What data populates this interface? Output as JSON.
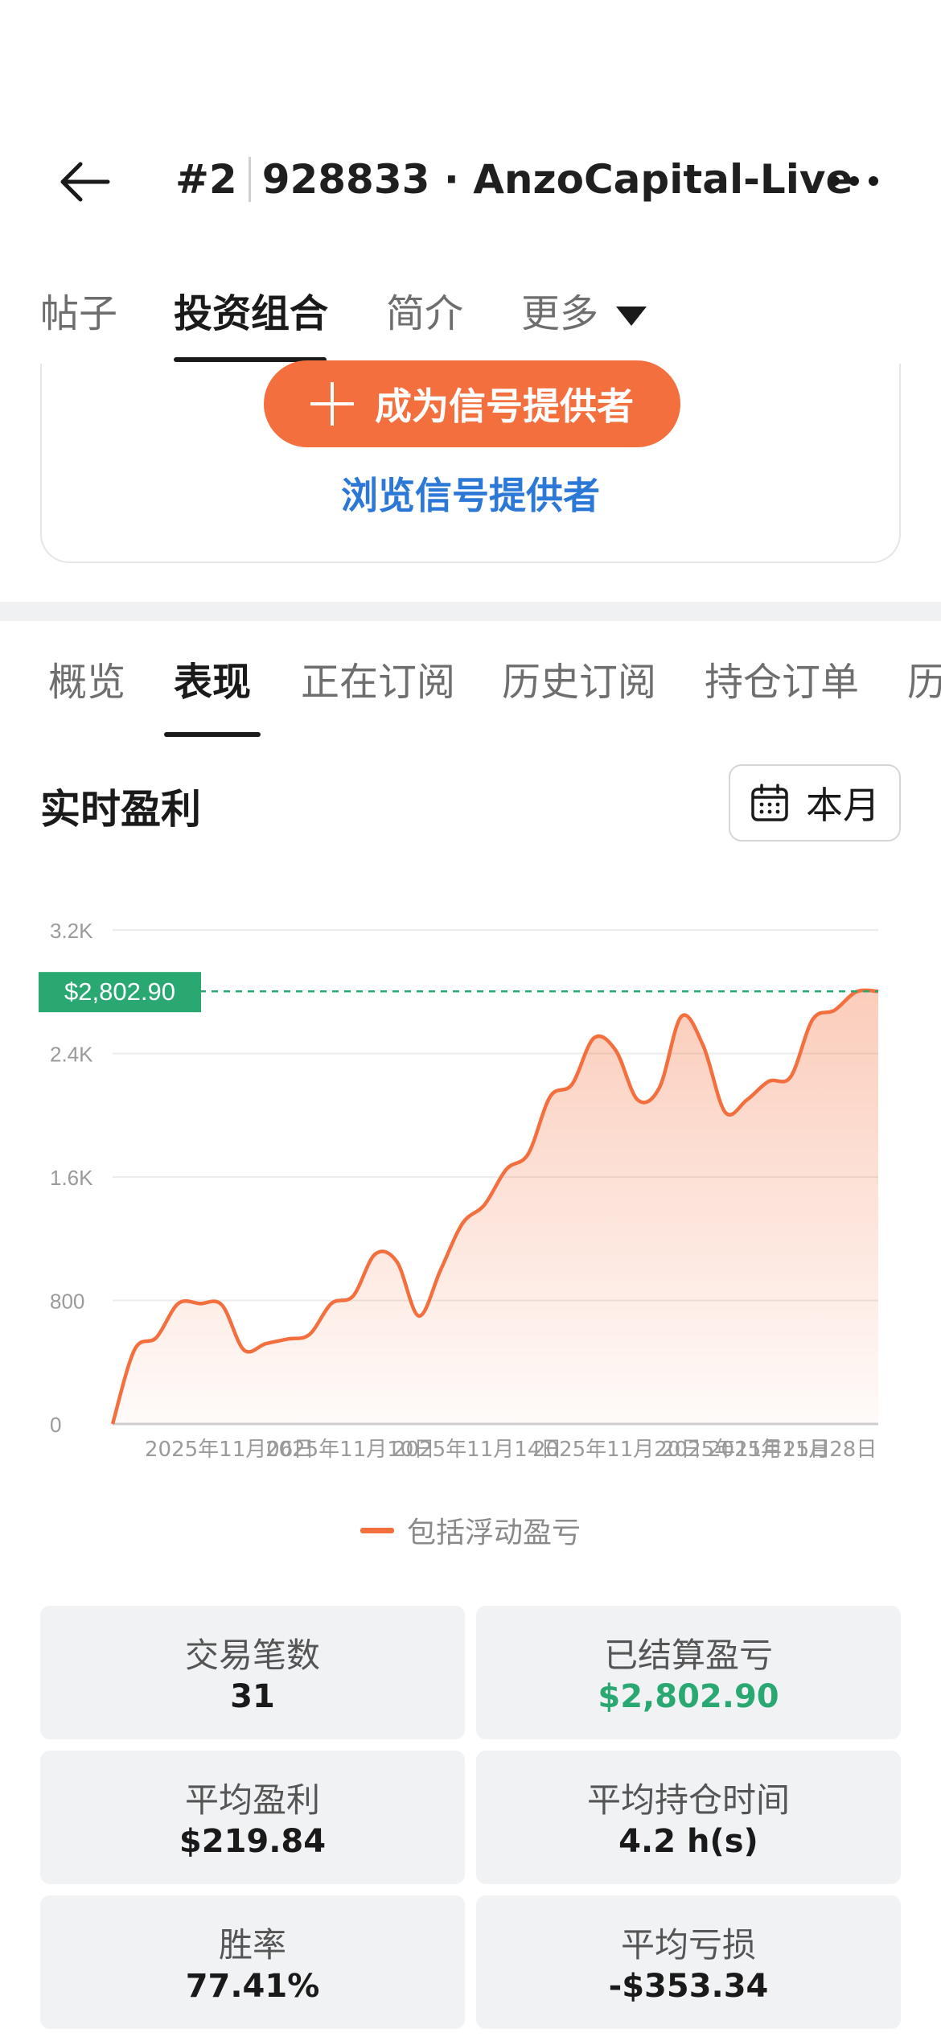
{
  "header": {
    "rank": "#2",
    "account": "928833 · AnzoCapital-Live"
  },
  "top_tabs": [
    {
      "label": "帖子"
    },
    {
      "label": "投资组合"
    },
    {
      "label": "简介"
    },
    {
      "label": "更多"
    }
  ],
  "promo": {
    "become_label": "成为信号提供者",
    "browse_label": "浏览信号提供者"
  },
  "section_tabs": [
    {
      "label": "概览"
    },
    {
      "label": "表现"
    },
    {
      "label": "正在订阅"
    },
    {
      "label": "历史订阅"
    },
    {
      "label": "持仓订单"
    },
    {
      "label": "历"
    }
  ],
  "section": {
    "title": "实时盈利",
    "period_label": "本月"
  },
  "chart_data": {
    "type": "area",
    "ylim": [
      0,
      3200
    ],
    "yticks": [
      "0",
      "800",
      "1.6K",
      "2.4K",
      "3.2K"
    ],
    "xticks": [
      "2025年11月06日",
      "2025年11月10日",
      "2025年11月14日",
      "2025年11月20日",
      "2025年11月25日",
      "2025年11月28日"
    ],
    "current_label": "$2,802.90",
    "current_value": 2802.9,
    "series": [
      {
        "name": "包括浮动盈亏",
        "color": "#f36f3d",
        "values": [
          0,
          480,
          560,
          780,
          780,
          770,
          480,
          520,
          550,
          580,
          780,
          830,
          1100,
          1050,
          700,
          1000,
          1300,
          1420,
          1650,
          1750,
          2120,
          2200,
          2500,
          2420,
          2100,
          2180,
          2640,
          2450,
          2020,
          2100,
          2220,
          2250,
          2620,
          2680,
          2800,
          2802.9
        ]
      }
    ]
  },
  "stats": [
    {
      "label": "交易笔数",
      "value": "31"
    },
    {
      "label": "已结算盈亏",
      "value": "$2,802.90"
    },
    {
      "label": "平均盈利",
      "value": "$219.84"
    },
    {
      "label": "平均持仓时间",
      "value": "4.2 h(s)"
    },
    {
      "label": "胜率",
      "value": "77.41%"
    },
    {
      "label": "平均亏损",
      "value": "-$353.34"
    }
  ]
}
